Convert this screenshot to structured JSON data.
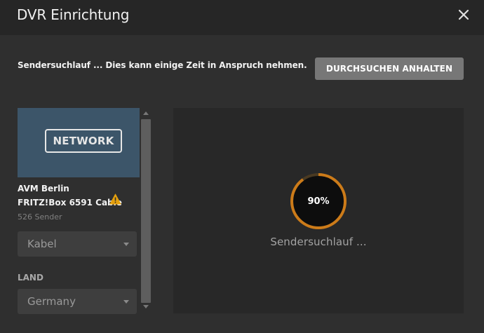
{
  "dialog": {
    "title": "DVR Einrichtung",
    "close_icon": "close-icon"
  },
  "intro_text": "Sendersuchlauf ... Dies kann einige Zeit in Anspruch nehmen.",
  "stop_button_label": "DURCHSUCHEN ANHALTEN",
  "device": {
    "badge": "NETWORK",
    "name": "AVM Berlin",
    "model": "FRITZ!Box 6591 Cable",
    "warning_icon": "warning-icon",
    "channel_count": "526 Sender",
    "tuner_type": "Kabel"
  },
  "country": {
    "label": "LAND",
    "value": "Germany"
  },
  "scan": {
    "progress_percent": 90,
    "progress_label": "90%",
    "status": "Sendersuchlauf ..."
  },
  "colors": {
    "accent": "#cc7b19",
    "warning": "#e5a00d",
    "header_bg": "#262626",
    "body_bg": "#2f2f2f",
    "device_card_bg": "#3c5569"
  }
}
